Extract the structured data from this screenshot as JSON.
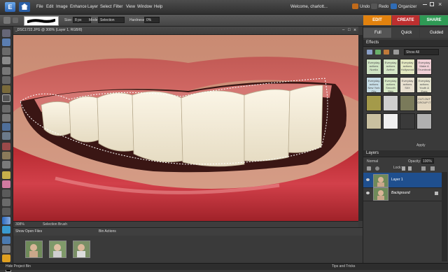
{
  "menubar": {
    "items": [
      "File",
      "Edit",
      "Image",
      "Enhance",
      "Layer",
      "Select",
      "Filter",
      "View",
      "Window",
      "Help"
    ],
    "welcome": "Welcome, charlott...",
    "undo": "Undo",
    "redo": "Redo",
    "organizer": "Organizer"
  },
  "options": {
    "size_label": "Size:",
    "size_value": "8 px",
    "mode_label": "Mode:",
    "mode_value": "Selection",
    "hardness_label": "Hardness:",
    "hardness_value": "0%"
  },
  "modes": {
    "edit": "EDIT",
    "create": "CREATE",
    "share": "SHARE",
    "full": "Full",
    "quick": "Quick",
    "guided": "Guided"
  },
  "document": {
    "title": "_DSC1722.JPG @ 308% (Layer 1, RGB/8)",
    "zoom": "308%",
    "tool_status": "Selection Brush"
  },
  "bin": {
    "show": "Show Open Files",
    "actions": "Bin Actions",
    "hide": "Hide Project Bin"
  },
  "effects": {
    "title": "Effects",
    "filter": "Show All",
    "apply": "Apply",
    "tiles": [
      "Everyday actions Noelia",
      "Everyday actions Aether",
      "Everyday actions Hollywood",
      "Everyday Make A Thumbnail",
      "Everyday actions New York City",
      "Everyday actions Smooth Skin",
      "Everyday actions SIIX",
      "Everyday actions Youth & Eyes",
      "",
      "",
      "",
      "CUT-OUT GROUP IT",
      "",
      "",
      "",
      ""
    ]
  },
  "layers": {
    "title": "Layers",
    "blend": "Normal",
    "opacity_label": "Opacity:",
    "opacity_value": "100%",
    "lock_label": "Lock:",
    "items": [
      "Layer 1",
      "Background"
    ]
  },
  "tips": "Tips and Tricks",
  "colors": {
    "edit": "#e2820e",
    "create": "#bd2f2f",
    "share": "#2f9a55",
    "selected_layer": "#1f4f8e"
  }
}
